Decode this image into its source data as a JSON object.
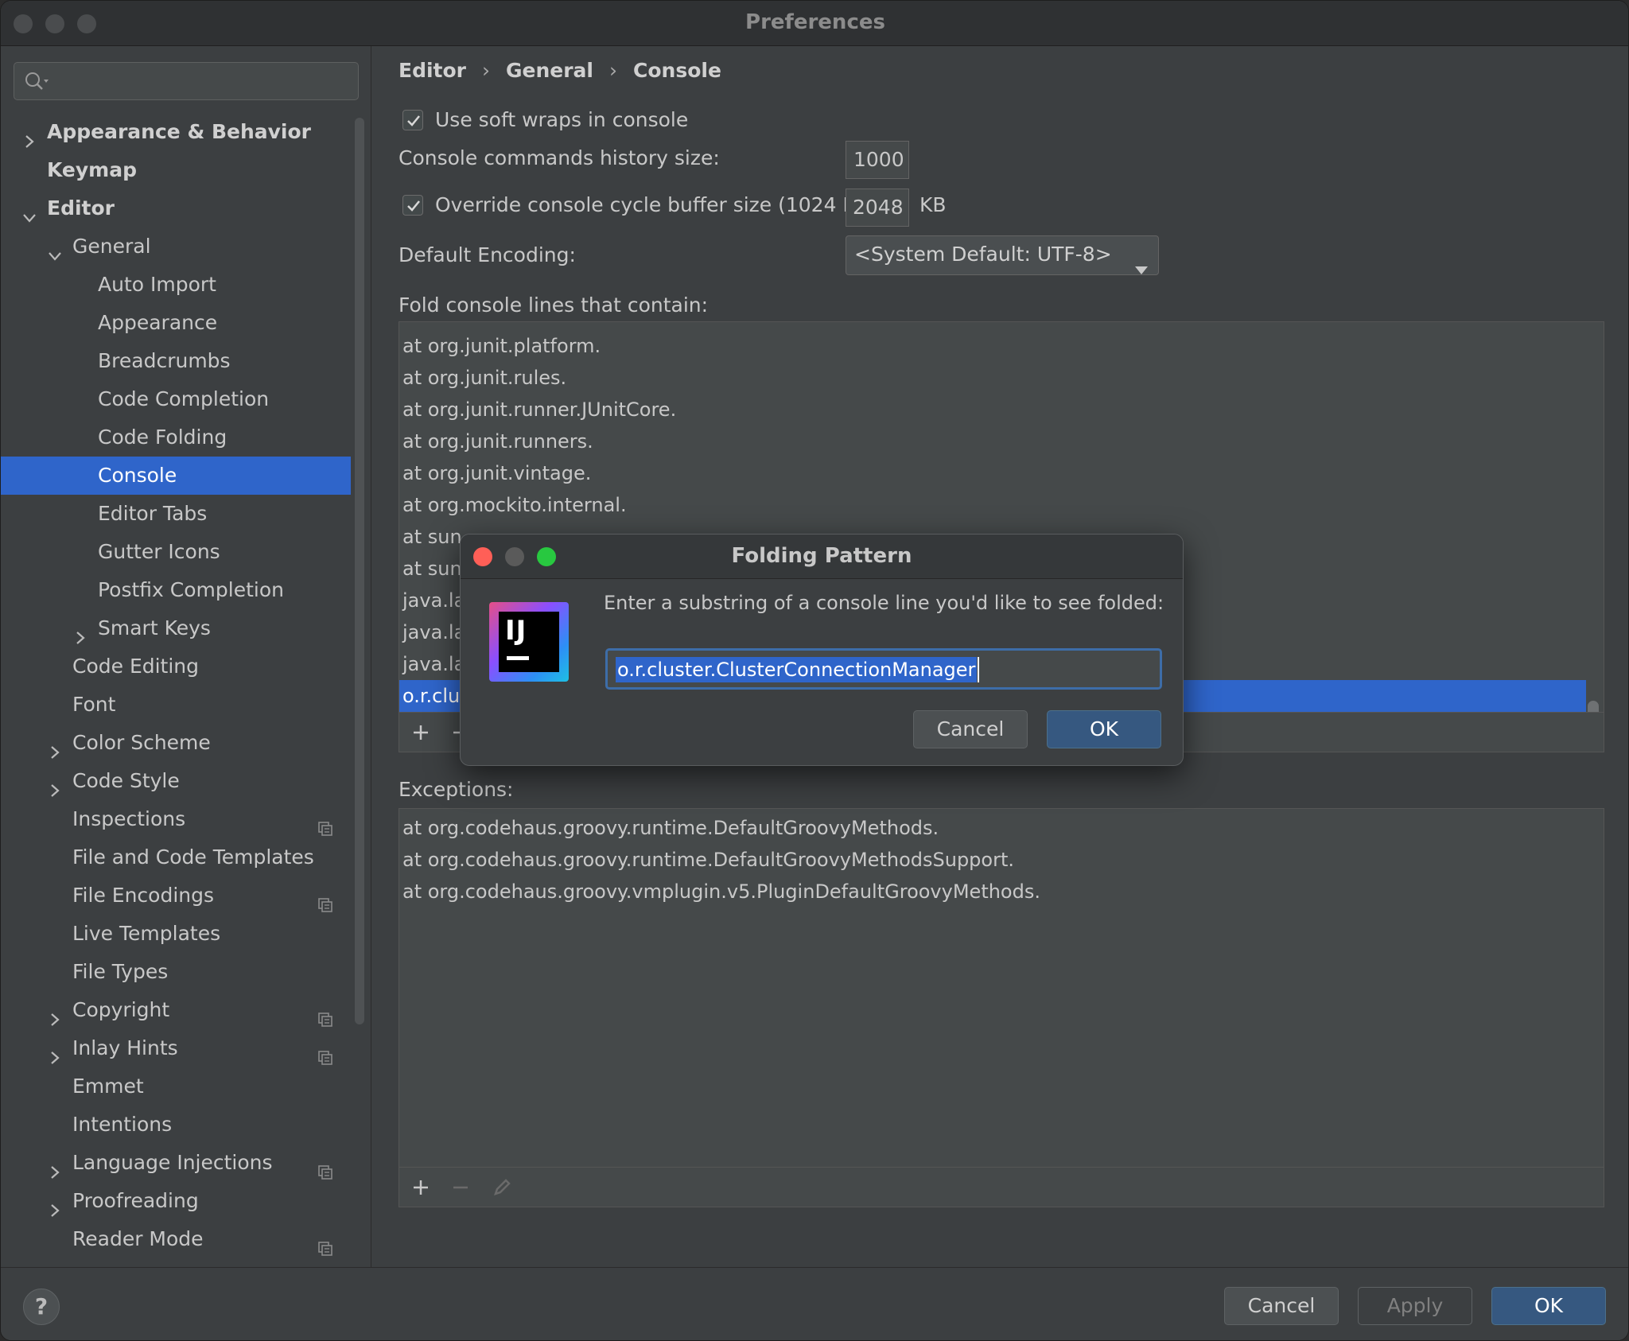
{
  "window": {
    "title": "Preferences"
  },
  "search": {
    "placeholder": ""
  },
  "sidebar": {
    "items": [
      {
        "label": "Appearance & Behavior",
        "level": 0,
        "chevron": "right",
        "bold": true
      },
      {
        "label": "Keymap",
        "level": 0,
        "chevron": "none",
        "bold": true
      },
      {
        "label": "Editor",
        "level": 0,
        "chevron": "down",
        "bold": true
      },
      {
        "label": "General",
        "level": 1,
        "chevron": "down"
      },
      {
        "label": "Auto Import",
        "level": 2,
        "chevron": "none"
      },
      {
        "label": "Appearance",
        "level": 2,
        "chevron": "none"
      },
      {
        "label": "Breadcrumbs",
        "level": 2,
        "chevron": "none"
      },
      {
        "label": "Code Completion",
        "level": 2,
        "chevron": "none"
      },
      {
        "label": "Code Folding",
        "level": 2,
        "chevron": "none"
      },
      {
        "label": "Console",
        "level": 2,
        "chevron": "none",
        "selected": true
      },
      {
        "label": "Editor Tabs",
        "level": 2,
        "chevron": "none"
      },
      {
        "label": "Gutter Icons",
        "level": 2,
        "chevron": "none"
      },
      {
        "label": "Postfix Completion",
        "level": 2,
        "chevron": "none"
      },
      {
        "label": "Smart Keys",
        "level": 2,
        "chevron": "right"
      },
      {
        "label": "Code Editing",
        "level": 1,
        "chevron": "none"
      },
      {
        "label": "Font",
        "level": 1,
        "chevron": "none"
      },
      {
        "label": "Color Scheme",
        "level": 1,
        "chevron": "right"
      },
      {
        "label": "Code Style",
        "level": 1,
        "chevron": "right"
      },
      {
        "label": "Inspections",
        "level": 1,
        "chevron": "none",
        "project": true
      },
      {
        "label": "File and Code Templates",
        "level": 1,
        "chevron": "none"
      },
      {
        "label": "File Encodings",
        "level": 1,
        "chevron": "none",
        "project": true
      },
      {
        "label": "Live Templates",
        "level": 1,
        "chevron": "none"
      },
      {
        "label": "File Types",
        "level": 1,
        "chevron": "none"
      },
      {
        "label": "Copyright",
        "level": 1,
        "chevron": "right",
        "project": true
      },
      {
        "label": "Inlay Hints",
        "level": 1,
        "chevron": "right",
        "project": true
      },
      {
        "label": "Emmet",
        "level": 1,
        "chevron": "none"
      },
      {
        "label": "Intentions",
        "level": 1,
        "chevron": "none"
      },
      {
        "label": "Language Injections",
        "level": 1,
        "chevron": "right",
        "project": true
      },
      {
        "label": "Proofreading",
        "level": 1,
        "chevron": "right"
      },
      {
        "label": "Reader Mode",
        "level": 1,
        "chevron": "none",
        "project": true
      }
    ]
  },
  "breadcrumb": {
    "part1": "Editor",
    "part2": "General",
    "part3": "Console",
    "sep": "›"
  },
  "settings": {
    "soft_wraps_label": "Use soft wraps in console",
    "soft_wraps_checked": true,
    "history_label": "Console commands history size:",
    "history_value": "1000",
    "override_label": "Override console cycle buffer size (1024 KB)",
    "override_checked": true,
    "override_value": "2048",
    "override_unit": "KB",
    "encoding_label": "Default Encoding:",
    "encoding_value": "<System Default: UTF-8>",
    "fold_label": "Fold console lines that contain:",
    "exceptions_label": "Exceptions:"
  },
  "fold_list": [
    "at org.junit.platform.",
    "at org.junit.rules.",
    "at org.junit.runner.JUnitCore.",
    "at org.junit.runners.",
    "at org.junit.vintage.",
    "at org.mockito.internal.",
    "at sun.",
    "at sun.",
    "java.la",
    "java.la",
    "java.la",
    "o.r.clu"
  ],
  "exceptions_list": [
    "at org.codehaus.groovy.runtime.DefaultGroovyMethods.",
    "at org.codehaus.groovy.runtime.DefaultGroovyMethodsSupport.",
    "at org.codehaus.groovy.vmplugin.v5.PluginDefaultGroovyMethods."
  ],
  "dialog": {
    "title": "Folding Pattern",
    "prompt": "Enter a substring of a console line you'd like to see folded:",
    "value": "o.r.cluster.ClusterConnectionManager",
    "cancel_label": "Cancel",
    "ok_label": "OK",
    "logo_text": "IJ"
  },
  "footer": {
    "help_label": "?",
    "cancel_label": "Cancel",
    "apply_label": "Apply",
    "ok_label": "OK"
  },
  "colors": {
    "selection": "#2f65ca",
    "primary_button": "#365880",
    "close": "#ff5f57",
    "minimize": "#5a5a5a",
    "zoom": "#28c840"
  },
  "icons": {
    "search": "search-icon",
    "chevron_right": "chevron-right-icon",
    "chevron_down": "chevron-down-icon",
    "project": "project-level-icon",
    "add": "plus-icon",
    "remove": "minus-icon",
    "edit": "pencil-icon",
    "dropdown": "dropdown-arrow-icon",
    "check": "checkmark-icon"
  }
}
